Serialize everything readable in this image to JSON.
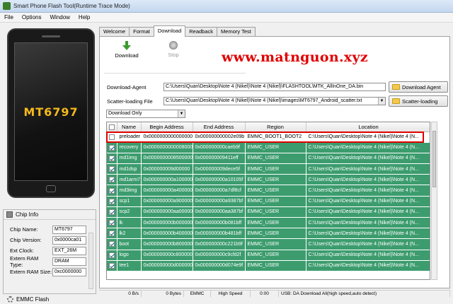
{
  "window": {
    "title": "Smart Phone Flash Tool(Runtime Trace Mode)"
  },
  "menu": [
    "File",
    "Options",
    "Window",
    "Help"
  ],
  "phone": {
    "chip_name": "MT6797"
  },
  "chip_info": {
    "title": "Chip Info",
    "rows": [
      {
        "label": "Chip Name:",
        "value": "MT6797"
      },
      {
        "label": "Chip Version:",
        "value": "0x0000ca01"
      },
      {
        "label": "Ext Clock:",
        "value": "EXT_26M"
      },
      {
        "label": "Extern RAM Type:",
        "value": "DRAM"
      },
      {
        "label": "Extern RAM Size:",
        "value": "0xc0000000"
      }
    ]
  },
  "emmc_flash": "EMMC Flash",
  "tabs": [
    "Welcome",
    "Format",
    "Download",
    "Readback",
    "Memory Test"
  ],
  "active_tab": "Download",
  "toolbar": {
    "download": "Download",
    "stop": "Stop"
  },
  "watermark": "www.matnguon.xyz",
  "download_agent": {
    "label": "Download-Agent",
    "path": "C:\\Users\\Quan\\Desktop\\Note 4 (Nikel)\\Note 4 (Nikel)\\FLASHTOOL\\MTK_AllInOne_DA.bin",
    "button": "Download Agent"
  },
  "scatter": {
    "label": "Scatter-loading File",
    "path": "C:\\Users\\Quan\\Desktop\\Note 4 (Nikel)\\Note 4 (Nikel)\\images\\MT6797_Android_scatter.txt",
    "button": "Scatter-loading"
  },
  "mode": "Download Only",
  "table": {
    "headers": [
      "",
      "Name",
      "Begin Address",
      "End Address",
      "Region",
      "Location"
    ],
    "rows": [
      {
        "checked": false,
        "name": "preloader",
        "begin": "0x0000000000000000",
        "end": "0x000000000002e09b",
        "region": "EMMC_BOOT1_BOOT2",
        "location": "C:\\Users\\Quan\\Desktop\\Note 4 (Nikel)\\Note 4 (N..."
      },
      {
        "checked": true,
        "name": "recovery",
        "begin": "0x0000000000008000",
        "end": "0x000000000caeb9f",
        "region": "EMMC_USER",
        "location": "C:\\Users\\Quan\\Desktop\\Note 4 (Nikel)\\Note 4 (N..."
      },
      {
        "checked": true,
        "name": "md1img",
        "begin": "0x0000000008500000",
        "end": "0x000000009411eff",
        "region": "EMMC_USER",
        "location": "C:\\Users\\Quan\\Desktop\\Note 4 (Nikel)\\Note 4 (N..."
      },
      {
        "checked": true,
        "name": "md1dsp",
        "begin": "0x000000009d00000",
        "end": "0x000000009dece5f",
        "region": "EMMC_USER",
        "location": "C:\\Users\\Quan\\Desktop\\Note 4 (Nikel)\\Note 4 (N..."
      },
      {
        "checked": true,
        "name": "md1arm7",
        "begin": "0x000000000a100000",
        "end": "0x000000000a10105f",
        "region": "EMMC_USER",
        "location": "C:\\Users\\Quan\\Desktop\\Note 4 (Nikel)\\Note 4 (N..."
      },
      {
        "checked": true,
        "name": "md3img",
        "begin": "0x000000000a400000",
        "end": "0x000000000a7df8cf",
        "region": "EMMC_USER",
        "location": "C:\\Users\\Quan\\Desktop\\Note 4 (Nikel)\\Note 4 (N..."
      },
      {
        "checked": true,
        "name": "scp1",
        "begin": "0x000000000a900000",
        "end": "0x000000000a9387bf",
        "region": "EMMC_USER",
        "location": "C:\\Users\\Quan\\Desktop\\Note 4 (Nikel)\\Note 4 (N..."
      },
      {
        "checked": true,
        "name": "scp2",
        "begin": "0x000000000aa00000",
        "end": "0x000000000aa387bf",
        "region": "EMMC_USER",
        "location": "C:\\Users\\Quan\\Desktop\\Note 4 (Nikel)\\Note 4 (N..."
      },
      {
        "checked": true,
        "name": "lk",
        "begin": "0x000000000b000000",
        "end": "0x000000000b081bff",
        "region": "EMMC_USER",
        "location": "C:\\Users\\Quan\\Desktop\\Note 4 (Nikel)\\Note 4 (N..."
      },
      {
        "checked": true,
        "name": "lk2",
        "begin": "0x000000000b400000",
        "end": "0x000000000b481bff",
        "region": "EMMC_USER",
        "location": "C:\\Users\\Quan\\Desktop\\Note 4 (Nikel)\\Note 4 (N..."
      },
      {
        "checked": true,
        "name": "boot",
        "begin": "0x000000000b800000",
        "end": "0x000000000c221b9f",
        "region": "EMMC_USER",
        "location": "C:\\Users\\Quan\\Desktop\\Note 4 (Nikel)\\Note 4 (N..."
      },
      {
        "checked": true,
        "name": "logo",
        "begin": "0x000000000c800000",
        "end": "0x000000000c9cfd2f",
        "region": "EMMC_USER",
        "location": "C:\\Users\\Quan\\Desktop\\Note 4 (Nikel)\\Note 4 (N..."
      },
      {
        "checked": true,
        "name": "tee1",
        "begin": "0x000000000d000000",
        "end": "0x000000000d074e9f",
        "region": "EMMC_USER",
        "location": "C:\\Users\\Quan\\Desktop\\Note 4 (Nikel)\\Note 4 (N..."
      }
    ]
  },
  "status": [
    "0 B/s",
    "0 Bytes",
    "EMMC",
    "High Speed",
    "0:00",
    "USB: DA Download All(high speed,auto detect)"
  ],
  "colors": {
    "row_green": "#3c9c6e",
    "highlight_red": "#e00000",
    "chip_label": "#f5b81c"
  }
}
